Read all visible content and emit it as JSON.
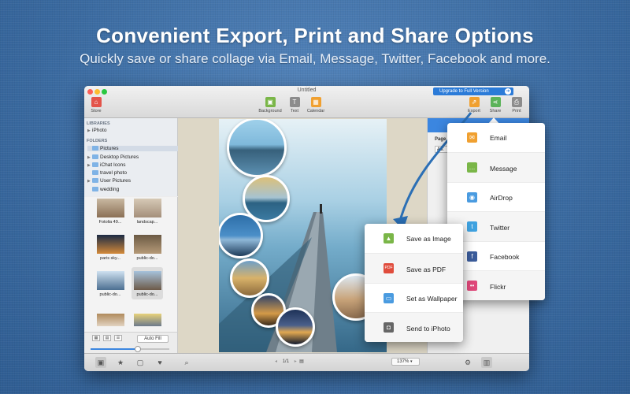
{
  "banner": {
    "headline": "Convenient Export, Print and Share Options",
    "subline": "Quickly save or share collage via Email, Message, Twitter, Facebook and more."
  },
  "window": {
    "title": "Untitled",
    "upgrade_label": "Upgrade to Full Version",
    "toolbar": {
      "store": "Store",
      "background": "Background",
      "text": "Text",
      "calendar": "Calendar",
      "export": "Export",
      "share": "Share",
      "print": "Print"
    }
  },
  "sidebar": {
    "libraries_header": "LIBRARIES",
    "libraries": [
      {
        "label": "iPhoto",
        "expandable": true
      }
    ],
    "folders_header": "FOLDERS",
    "folders": [
      {
        "label": "Pictures",
        "expandable": false,
        "selected": true
      },
      {
        "label": "Desktop Pictures",
        "expandable": true
      },
      {
        "label": "iChat Icons",
        "expandable": true
      },
      {
        "label": "travel photo",
        "expandable": false
      },
      {
        "label": "User Pictures",
        "expandable": true
      },
      {
        "label": "wedding",
        "expandable": false
      }
    ]
  },
  "thumbnails": [
    {
      "label": "Fotolia 49...",
      "colors": [
        "#c9b9a2",
        "#8a6f55"
      ]
    },
    {
      "label": "landscap...",
      "colors": [
        "#d6c9b6",
        "#a48f7a"
      ]
    },
    {
      "label": "paris sky...",
      "colors": [
        "#1b2a44",
        "#d48a3a"
      ]
    },
    {
      "label": "public-do...",
      "colors": [
        "#6b5a44",
        "#b59a78"
      ]
    },
    {
      "label": "public-do...",
      "colors": [
        "#cfe1f0",
        "#4c6f91"
      ]
    },
    {
      "label": "public-do...",
      "colors": [
        "#a6c2dc",
        "#6d5a48"
      ],
      "selected": true
    },
    {
      "label": "",
      "colors": [
        "#b08a5c",
        "#e2d3c1"
      ]
    },
    {
      "label": "",
      "colors": [
        "#e8d27a",
        "#6c7a8c"
      ]
    }
  ],
  "thumb_controls": {
    "auto_fill": "Auto Fill",
    "size_fraction": 0.6
  },
  "bottom": {
    "page": "1/1",
    "zoom": "137%"
  },
  "props": {
    "page_label": "Page",
    "page_size": "A6:"
  },
  "export_menu": [
    {
      "label": "Save as Image",
      "icon": "image-icon",
      "color": "#7ab648"
    },
    {
      "label": "Save as PDF",
      "icon": "pdf-icon",
      "color": "#e04c3c"
    },
    {
      "label": "Set as Wallpaper",
      "icon": "wallpaper-icon",
      "color": "#4a9be0"
    },
    {
      "label": "Send to iPhoto",
      "icon": "camera-icon",
      "color": "#666666"
    }
  ],
  "share_menu": [
    {
      "label": "Email",
      "icon": "email-icon",
      "color": "#f0a030"
    },
    {
      "label": "Message",
      "icon": "message-icon",
      "color": "#7ab648"
    },
    {
      "label": "AirDrop",
      "icon": "airdrop-icon",
      "color": "#4a9be0"
    },
    {
      "label": "Twitter",
      "icon": "twitter-icon",
      "color": "#3fa2e0"
    },
    {
      "label": "Facebook",
      "icon": "facebook-icon",
      "color": "#3b5c9b"
    },
    {
      "label": "Flickr",
      "icon": "flickr-icon",
      "color": "#e0487a"
    }
  ]
}
